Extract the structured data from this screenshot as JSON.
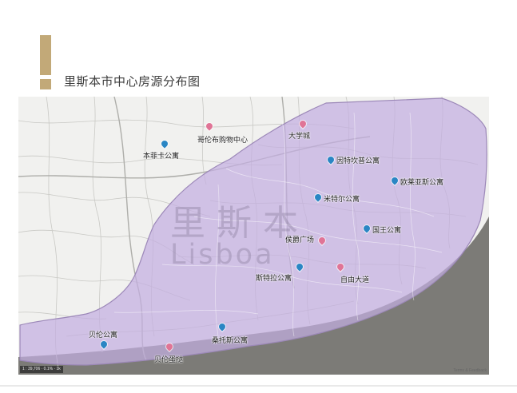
{
  "title": "里斯本市中心房源分布图",
  "colors": {
    "accent": "#c2a978",
    "district_fill": "#c4aee0",
    "pin_apartment": "#2a86c4",
    "pin_landmark": "#e07496",
    "water": "#7c7b77",
    "land": "#f1f1ef"
  },
  "map": {
    "watermark_cn": "里斯本",
    "watermark_en": "Lisboa",
    "scale_text": "1 : 39,706 · 0.1%  · 1k",
    "attribution": "Terms & Feedback"
  },
  "apartments": [
    {
      "name": "本菲卡公寓",
      "icon": "map-pin"
    },
    {
      "name": "因特坎普公寓",
      "icon": "map-pin"
    },
    {
      "name": "欧莱亚斯公寓",
      "icon": "map-pin"
    },
    {
      "name": "米特尔公寓",
      "icon": "map-pin"
    },
    {
      "name": "国王公寓",
      "icon": "map-pin"
    },
    {
      "name": "斯特拉公寓",
      "icon": "map-pin"
    },
    {
      "name": "贝伦公寓",
      "icon": "map-pin"
    },
    {
      "name": "桑托斯公寓",
      "icon": "map-pin"
    }
  ],
  "landmarks": [
    {
      "name": "哥伦布购物中心",
      "icon": "map-pin"
    },
    {
      "name": "大学城",
      "icon": "map-pin"
    },
    {
      "name": "侯爵广场",
      "icon": "map-pin"
    },
    {
      "name": "自由大道",
      "icon": "map-pin"
    },
    {
      "name": "贝伦蛋挞",
      "icon": "map-pin"
    }
  ]
}
